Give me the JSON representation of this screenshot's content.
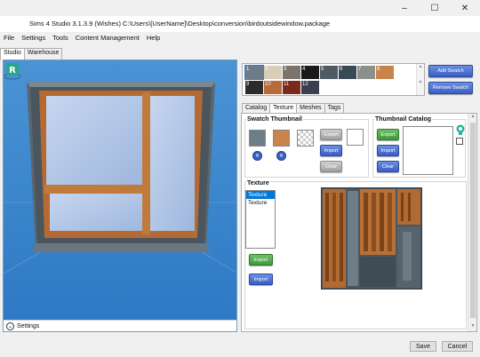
{
  "window": {
    "title": "Sims 4 Studio 3.1.3.9 (Wishes)  C:\\Users\\[UserName]\\Desktop\\conversion\\birdoutsidewindow.package",
    "minimize": "–",
    "maximize": "☐",
    "close": "✕"
  },
  "menu": [
    "File",
    "Settings",
    "Tools",
    "Content Management",
    "Help"
  ],
  "main_tabs": [
    "Studio",
    "Warehouse"
  ],
  "viewport": {
    "settings_label": "Settings",
    "chevron": "⌄",
    "logo_letter": "R"
  },
  "swatches": [
    {
      "num": "1",
      "color": "#6d7d88"
    },
    {
      "num": "2",
      "color": "#d9cdb8"
    },
    {
      "num": "3",
      "color": "#7a746c"
    },
    {
      "num": "4",
      "color": "#1a1a1a"
    },
    {
      "num": "5",
      "color": "#505a64"
    },
    {
      "num": "6",
      "color": "#3a4a55"
    },
    {
      "num": "7",
      "color": "#8c8f8a"
    },
    {
      "num": "8",
      "color": "#c8844a"
    },
    {
      "num": "9",
      "color": "#2b2b2b"
    },
    {
      "num": "10",
      "color": "#b86a3a"
    },
    {
      "num": "11",
      "color": "#7a2a1a"
    },
    {
      "num": "12",
      "color": "#3a4050"
    }
  ],
  "swatch_buttons": {
    "add": "Add Swatch",
    "remove": "Remove Swatch"
  },
  "sub_tabs": [
    "Catalog",
    "Texture",
    "Meshes",
    "Tags"
  ],
  "swatch_thumbnail": {
    "title": "Swatch Thumbnail",
    "export": "Export",
    "import": "Import",
    "clear": "Clear",
    "x_icon": "✕"
  },
  "thumbnail_catalog": {
    "title": "Thumbnail Catalog",
    "export": "Export",
    "import": "Import",
    "clear": "Clear"
  },
  "texture": {
    "title": "Texture",
    "items": [
      "Texture",
      "Texture"
    ],
    "export": "Export",
    "import": "Import"
  },
  "footer": {
    "save": "Save",
    "cancel": "Cancel"
  }
}
